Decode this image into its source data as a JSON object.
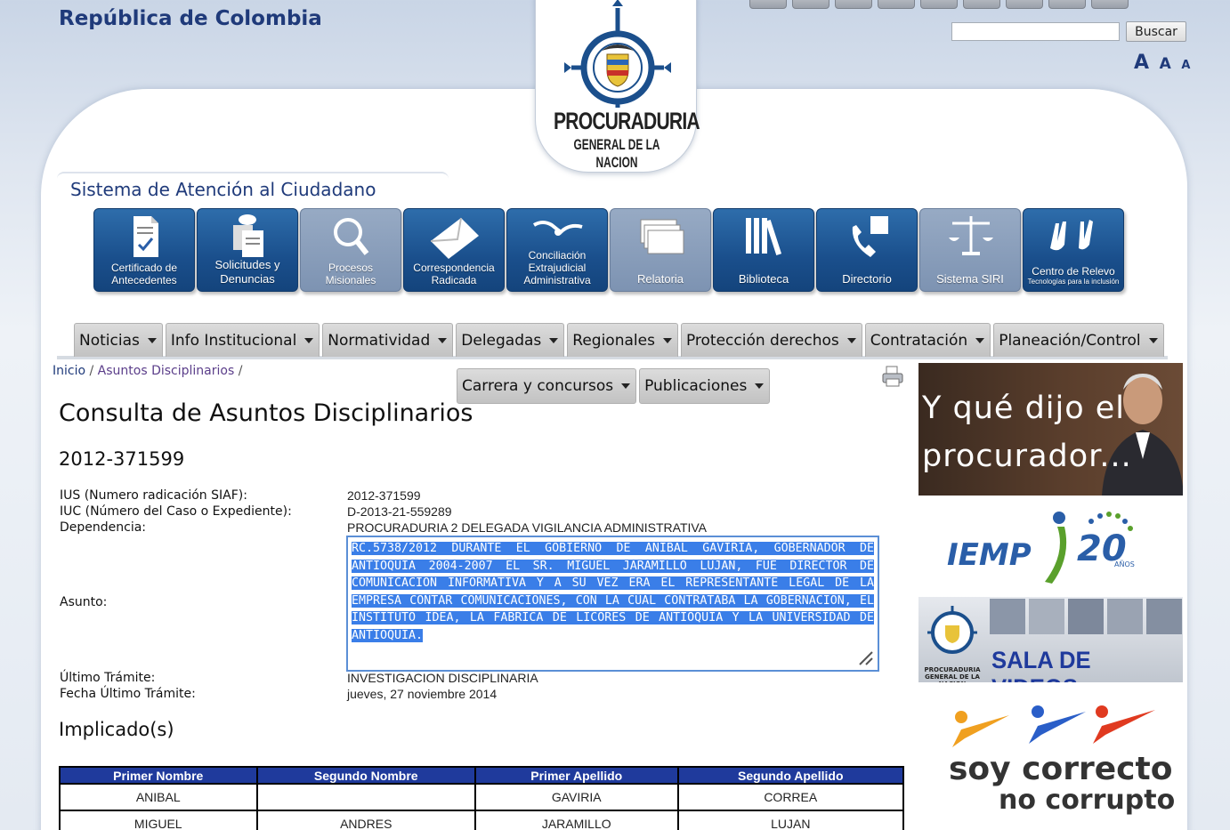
{
  "header": {
    "country": "República de Colombia",
    "search_placeholder": "",
    "search_button": "Buscar",
    "font_sizes": [
      "A",
      "A",
      "A"
    ],
    "logo_line1": "PROCURADURIA",
    "logo_line2": "GENERAL DE LA NACION"
  },
  "sac": {
    "title": "Sistema de Atención al Ciudadano",
    "tiles": [
      {
        "label": "Certificado de Antecedentes",
        "icon": "certificate-icon",
        "state": "active"
      },
      {
        "label": "Solicitudes y Denuncias",
        "icon": "documents-icon",
        "state": "active"
      },
      {
        "label": "Procesos Misionales",
        "icon": "magnifier-icon",
        "state": "disabled"
      },
      {
        "label": "Correspondencia Radicada",
        "icon": "envelope-icon",
        "state": "active"
      },
      {
        "label": "Conciliación Extrajudicial Administrativa",
        "icon": "handshake-icon",
        "state": "active"
      },
      {
        "label": "Relatoria",
        "icon": "stack-icon",
        "state": "disabled"
      },
      {
        "label": "Biblioteca",
        "icon": "books-icon",
        "state": "active"
      },
      {
        "label": "Directorio",
        "icon": "phone-icon",
        "state": "active"
      },
      {
        "label": "Sistema SIRI",
        "icon": "scales-icon",
        "state": "disabled"
      },
      {
        "label": "Centro de Relevo",
        "sub": "Tecnologías para la inclusión",
        "icon": "sign-language-icon",
        "state": "active"
      }
    ]
  },
  "menu": {
    "row1": [
      "Noticias",
      "Info Institucional",
      "Normatividad",
      "Delegadas",
      "Regionales",
      "Protección derechos",
      "Contratación",
      "Planeación/Control"
    ],
    "row2": [
      "Carrera y concursos",
      "Publicaciones"
    ]
  },
  "breadcrumb": {
    "home": "Inicio",
    "current": "Asuntos Disciplinarios",
    "sep": "/"
  },
  "page": {
    "title": "Consulta de Asuntos Disciplinarios",
    "case_number": "2012-371599",
    "fields": {
      "ius_label": "IUS (Numero radicación SIAF):",
      "ius_value": "2012-371599",
      "iuc_label": "IUC (Número del Caso o Expediente):",
      "iuc_value": "D-2013-21-559289",
      "dep_label": "Dependencia:",
      "dep_value": "PROCURADURIA 2 DELEGADA VIGILANCIA ADMINISTRATIVA",
      "asunto_label": "Asunto:",
      "asunto_value": "RC.5738/2012 DURANTE EL GOBIERNO DE ANIBAL GAVIRIA, GOBERNADOR DE ANTIOQUIA 2004-2007 EL SR. MIGUEL JARAMILLO LUJAN, FUE DIRECTOR DE COMUNICACION INFORMATIVA Y A SU VEZ ERA EL REPRESENTANTE LEGAL DE LA EMPRESA CONTAR COMUNICACIONES, CON LA CUAL CONTRATABA LA GOBERNACION, EL INSTITUTO IDEA, LA FABRICA DE LICORES DE ANTIOQUIA Y LA UNIVERSIDAD DE ANTIOQUIA.",
      "ultimo_label": "Último Trámite:",
      "ultimo_value": "INVESTIGACION DISCIPLINARIA",
      "fecha_label": "Fecha Último Trámite:",
      "fecha_value": "jueves, 27 noviembre 2014"
    },
    "implicados_title": "Implicado(s)",
    "table": {
      "headers": [
        "Primer Nombre",
        "Segundo Nombre",
        "Primer Apellido",
        "Segundo Apellido"
      ],
      "rows": [
        [
          "ANIBAL",
          "",
          "GAVIRIA",
          "CORREA"
        ],
        [
          "MIGUEL",
          "ANDRES",
          "JARAMILLO",
          "LUJAN"
        ]
      ]
    }
  },
  "sidebar": {
    "ad1_text": "Y qué dijo el procurador...",
    "ad2_text": "IEMP",
    "ad2_years": "20",
    "ad2_anos": "AÑOS",
    "ad3_text": "SALA DE VIDEOS",
    "ad3_mini": "PROCURADURIA GENERAL DE LA NACION",
    "ad4_line1": "soy correcto",
    "ad4_line2": "no corrupto"
  },
  "colors": {
    "brand_blue": "#1f3a7a",
    "tile_blue": "#1a4f8c",
    "table_header": "#1f3a9c",
    "selection": "#3a7ee8"
  }
}
